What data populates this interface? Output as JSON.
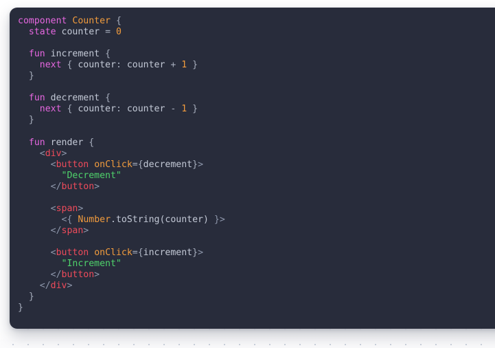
{
  "surface": {
    "background_color": "#fbfbfc",
    "dot_grid_color": "#c3cbd8",
    "dot_spacing_px": 22
  },
  "code_card": {
    "background_color": "#282c3b",
    "language": "mint",
    "corner_radius_px": 11
  },
  "theme": {
    "keyword": "#e667e0",
    "type": "#f29c3d",
    "number": "#f29c3d",
    "attribute": "#f29c3d",
    "string": "#4fd36b",
    "tag": "#ef4b5b",
    "punctuation": "#8e97ab",
    "identifier": "#c3c9d6",
    "operator": "#a7aebd"
  },
  "code": {
    "lines": [
      "component Counter {",
      "  state counter = 0",
      "",
      "  fun increment {",
      "    next { counter: counter + 1 }",
      "  }",
      "",
      "  fun decrement {",
      "    next { counter: counter - 1 }",
      "  }",
      "",
      "  fun render {",
      "    <div>",
      "      <button onClick={decrement}>",
      "        \"Decrement\"",
      "      </button>",
      "",
      "      <span>",
      "        <{ Number.toString(counter) }>",
      "      </span>",
      "",
      "      <button onClick={increment}>",
      "        \"Increment\"",
      "      </button>",
      "    </div>",
      "  }",
      "}"
    ],
    "tokens": [
      [
        {
          "t": "kw",
          "v": "component"
        },
        {
          "t": "id",
          "v": " "
        },
        {
          "t": "typ",
          "v": "Counter"
        },
        {
          "t": "op",
          "v": " {"
        }
      ],
      [
        {
          "t": "id",
          "v": "  "
        },
        {
          "t": "kw",
          "v": "state"
        },
        {
          "t": "id",
          "v": " counter "
        },
        {
          "t": "op",
          "v": "= "
        },
        {
          "t": "num",
          "v": "0"
        }
      ],
      [],
      [
        {
          "t": "id",
          "v": "  "
        },
        {
          "t": "kw",
          "v": "fun"
        },
        {
          "t": "id",
          "v": " increment"
        },
        {
          "t": "op",
          "v": " {"
        }
      ],
      [
        {
          "t": "id",
          "v": "    "
        },
        {
          "t": "kw",
          "v": "next"
        },
        {
          "t": "op",
          "v": " { "
        },
        {
          "t": "id",
          "v": "counter"
        },
        {
          "t": "op",
          "v": ": "
        },
        {
          "t": "id",
          "v": "counter "
        },
        {
          "t": "op",
          "v": "+ "
        },
        {
          "t": "num",
          "v": "1"
        },
        {
          "t": "op",
          "v": " }"
        }
      ],
      [
        {
          "t": "op",
          "v": "  }"
        }
      ],
      [],
      [
        {
          "t": "id",
          "v": "  "
        },
        {
          "t": "kw",
          "v": "fun"
        },
        {
          "t": "id",
          "v": " decrement"
        },
        {
          "t": "op",
          "v": " {"
        }
      ],
      [
        {
          "t": "id",
          "v": "    "
        },
        {
          "t": "kw",
          "v": "next"
        },
        {
          "t": "op",
          "v": " { "
        },
        {
          "t": "id",
          "v": "counter"
        },
        {
          "t": "op",
          "v": ": "
        },
        {
          "t": "id",
          "v": "counter "
        },
        {
          "t": "op",
          "v": "- "
        },
        {
          "t": "num",
          "v": "1"
        },
        {
          "t": "op",
          "v": " }"
        }
      ],
      [
        {
          "t": "op",
          "v": "  }"
        }
      ],
      [],
      [
        {
          "t": "id",
          "v": "  "
        },
        {
          "t": "kw",
          "v": "fun"
        },
        {
          "t": "id",
          "v": " render"
        },
        {
          "t": "op",
          "v": " {"
        }
      ],
      [
        {
          "t": "id",
          "v": "    "
        },
        {
          "t": "pun",
          "v": "<"
        },
        {
          "t": "tag",
          "v": "div"
        },
        {
          "t": "pun",
          "v": ">"
        }
      ],
      [
        {
          "t": "id",
          "v": "      "
        },
        {
          "t": "pun",
          "v": "<"
        },
        {
          "t": "tag",
          "v": "button"
        },
        {
          "t": "id",
          "v": " "
        },
        {
          "t": "attr",
          "v": "onClick"
        },
        {
          "t": "op",
          "v": "={"
        },
        {
          "t": "id",
          "v": "decrement"
        },
        {
          "t": "op",
          "v": "}"
        },
        {
          "t": "pun",
          "v": ">"
        }
      ],
      [
        {
          "t": "id",
          "v": "        "
        },
        {
          "t": "str",
          "v": "\"Decrement\""
        }
      ],
      [
        {
          "t": "id",
          "v": "      "
        },
        {
          "t": "pun",
          "v": "</"
        },
        {
          "t": "tag",
          "v": "button"
        },
        {
          "t": "pun",
          "v": ">"
        }
      ],
      [],
      [
        {
          "t": "id",
          "v": "      "
        },
        {
          "t": "pun",
          "v": "<"
        },
        {
          "t": "tag",
          "v": "span"
        },
        {
          "t": "pun",
          "v": ">"
        }
      ],
      [
        {
          "t": "id",
          "v": "        "
        },
        {
          "t": "pun",
          "v": "<{"
        },
        {
          "t": "id",
          "v": " "
        },
        {
          "t": "typ",
          "v": "Number"
        },
        {
          "t": "id",
          "v": ".toString(counter) "
        },
        {
          "t": "pun",
          "v": "}>"
        }
      ],
      [
        {
          "t": "id",
          "v": "      "
        },
        {
          "t": "pun",
          "v": "</"
        },
        {
          "t": "tag",
          "v": "span"
        },
        {
          "t": "pun",
          "v": ">"
        }
      ],
      [],
      [
        {
          "t": "id",
          "v": "      "
        },
        {
          "t": "pun",
          "v": "<"
        },
        {
          "t": "tag",
          "v": "button"
        },
        {
          "t": "id",
          "v": " "
        },
        {
          "t": "attr",
          "v": "onClick"
        },
        {
          "t": "op",
          "v": "={"
        },
        {
          "t": "id",
          "v": "increment"
        },
        {
          "t": "op",
          "v": "}"
        },
        {
          "t": "pun",
          "v": ">"
        }
      ],
      [
        {
          "t": "id",
          "v": "        "
        },
        {
          "t": "str",
          "v": "\"Increment\""
        }
      ],
      [
        {
          "t": "id",
          "v": "      "
        },
        {
          "t": "pun",
          "v": "</"
        },
        {
          "t": "tag",
          "v": "button"
        },
        {
          "t": "pun",
          "v": ">"
        }
      ],
      [
        {
          "t": "id",
          "v": "    "
        },
        {
          "t": "pun",
          "v": "</"
        },
        {
          "t": "tag",
          "v": "div"
        },
        {
          "t": "pun",
          "v": ">"
        }
      ],
      [
        {
          "t": "op",
          "v": "  }"
        }
      ],
      [
        {
          "t": "op",
          "v": "}"
        }
      ]
    ]
  }
}
